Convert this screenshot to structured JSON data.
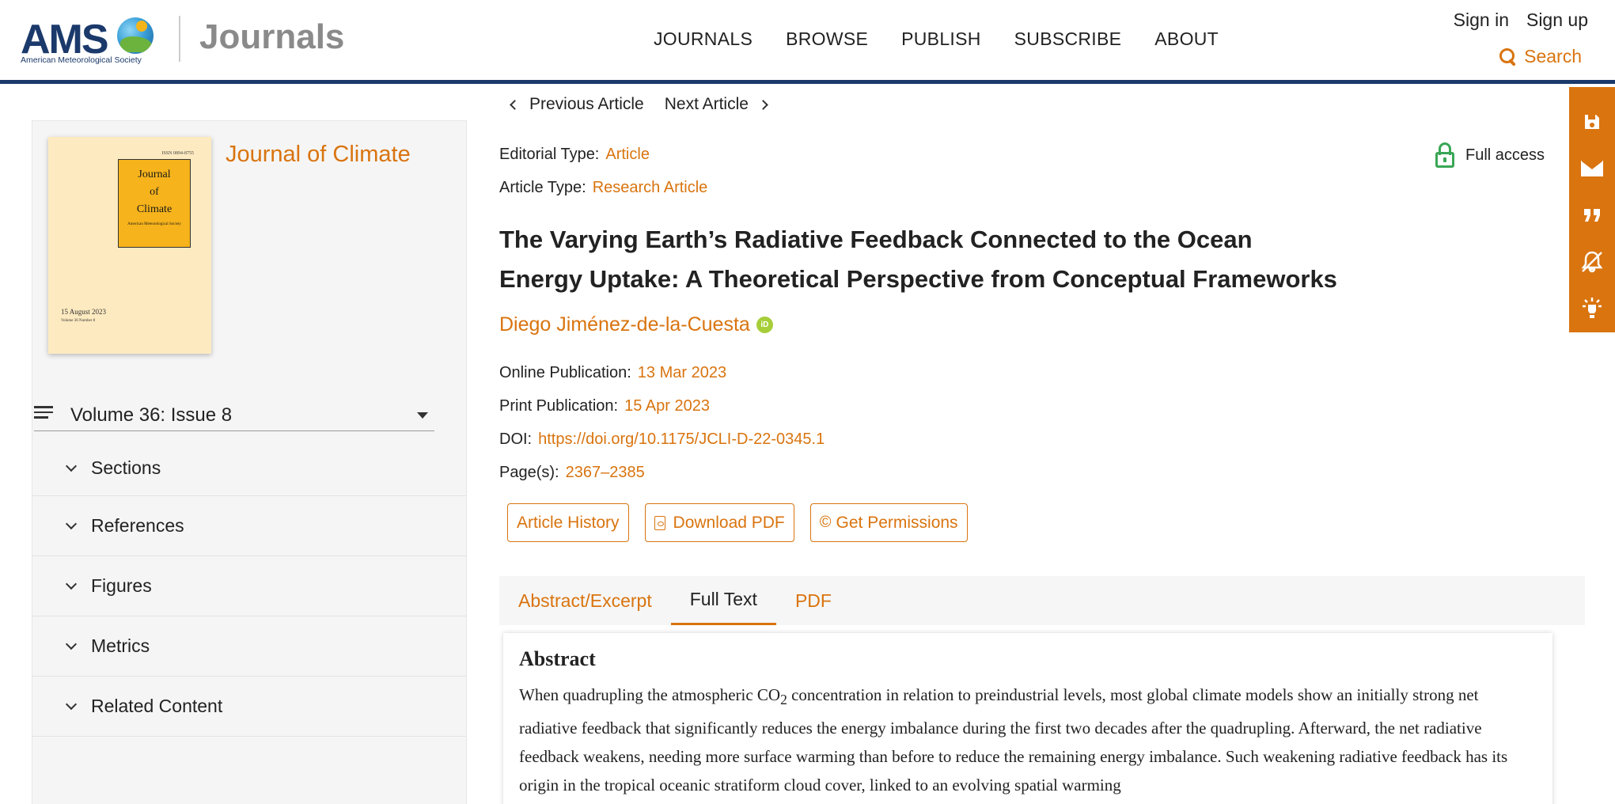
{
  "header": {
    "logo_text": "AMS",
    "logo_subtitle": "American Meteorological Society",
    "brand": "Journals",
    "nav": [
      "JOURNALS",
      "BROWSE",
      "PUBLISH",
      "SUBSCRIBE",
      "ABOUT"
    ],
    "sign_in": "Sign in",
    "sign_up": "Sign up",
    "search": "Search"
  },
  "article_nav": {
    "previous": "Previous Article",
    "next": "Next Article"
  },
  "sidebar": {
    "journal_name": "Journal of Climate",
    "cover": {
      "issn": "ISSN 0894-8755",
      "title_line1": "Journal",
      "title_line2": "of",
      "title_line3": "Climate",
      "publisher": "American Meteorological Society",
      "date": "15 August 2023",
      "volume": "Volume 36    Number 8"
    },
    "issue_label": "Volume 36: Issue 8",
    "sections": [
      "Sections",
      "References",
      "Figures",
      "Metrics",
      "Related Content"
    ]
  },
  "article": {
    "editorial_type_label": "Editorial Type:",
    "editorial_type": "Article",
    "article_type_label": "Article Type:",
    "article_type": "Research Article",
    "access": "Full access",
    "title": "The Varying Earth’s Radiative Feedback Connected to the Ocean Energy Uptake: A Theoretical Perspective from Conceptual Frameworks",
    "author": "Diego Jiménez-de-la-Cuesta",
    "orcid_badge": "iD",
    "online_pub_label": "Online Publication:",
    "online_pub": "13 Mar 2023",
    "print_pub_label": "Print Publication:",
    "print_pub": "15 Apr 2023",
    "doi_label": "DOI:",
    "doi": "https://doi.org/10.1175/JCLI-D-22-0345.1",
    "pages_label": "Page(s):",
    "pages": "2367–2385",
    "buttons": {
      "history": "Article History",
      "download": "Download PDF",
      "permissions": "Get Permissions",
      "copyright_symbol": "©"
    },
    "tabs": [
      "Abstract/Excerpt",
      "Full Text",
      "PDF"
    ],
    "abstract_heading": "Abstract",
    "abstract_text_pre": "When quadrupling the atmospheric CO",
    "abstract_subscript": "2",
    "abstract_text_post": " concentration in relation to preindustrial levels, most global climate models show an initially strong net radiative feedback that significantly reduces the energy imbalance during the first two decades after the quadrupling. Afterward, the net radiative feedback weakens, needing more surface warming than before to reduce the remaining energy imbalance. Such weakening radiative feedback has its origin in the tropical oceanic stratiform cloud cover, linked to an evolving spatial warming"
  },
  "colors": {
    "accent": "#d9740f",
    "navy": "#1b3a6b",
    "access_green": "#3aa655",
    "orcid_green": "#a6ce39"
  },
  "icons": [
    "search-icon",
    "save-icon",
    "email-icon",
    "quote-icon",
    "alert-off-icon",
    "lightbulb-icon",
    "lock-open-icon",
    "orcid-icon",
    "pdf-icon",
    "hamburger-icon",
    "chevron-down-icon",
    "chevron-left-icon",
    "chevron-right-icon"
  ]
}
